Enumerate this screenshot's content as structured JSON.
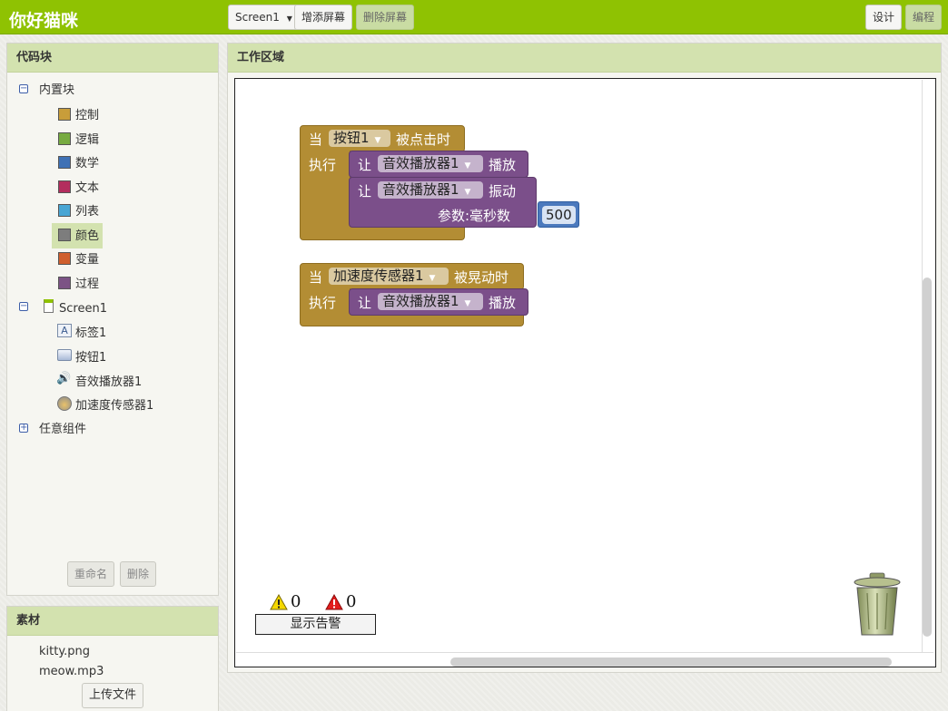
{
  "app": {
    "title": "你好猫咪"
  },
  "toolbar": {
    "screen_select": "Screen1",
    "add_screen": "增添屏幕",
    "remove_screen": "删除屏幕",
    "designer": "设计",
    "blocks": "编程"
  },
  "blocks_panel": {
    "title": "代码块",
    "builtin": {
      "label": "内置块",
      "items": [
        {
          "label": "控制",
          "color": "#c89d3a"
        },
        {
          "label": "逻辑",
          "color": "#77ab41"
        },
        {
          "label": "数学",
          "color": "#3f71b5"
        },
        {
          "label": "文本",
          "color": "#b32d5e"
        },
        {
          "label": "列表",
          "color": "#49a6d4"
        },
        {
          "label": "颜色",
          "color": "#7d7d7d"
        },
        {
          "label": "变量",
          "color": "#d05f2d"
        },
        {
          "label": "过程",
          "color": "#7c5385"
        }
      ]
    },
    "screen": {
      "label": "Screen1",
      "components": [
        {
          "label": "标签1",
          "icon": "label-icon"
        },
        {
          "label": "按钮1",
          "icon": "button-icon"
        },
        {
          "label": "音效播放器1",
          "icon": "speaker-icon"
        },
        {
          "label": "加速度传感器1",
          "icon": "accelerometer-icon"
        }
      ]
    },
    "any_component": "任意组件",
    "rename": "重命名",
    "delete": "删除"
  },
  "media_panel": {
    "title": "素材",
    "files": [
      "kitty.png",
      "meow.mp3"
    ],
    "upload": "上传文件"
  },
  "workspace": {
    "title": "工作区域",
    "block1": {
      "when": "当",
      "component": "按钮1",
      "event": "被点击时",
      "do": "执行",
      "stmt1": {
        "let": "让",
        "component": "音效播放器1",
        "method": "播放"
      },
      "stmt2": {
        "let": "让",
        "component": "音效播放器1",
        "method": "振动",
        "param": "参数:毫秒数",
        "value": "500"
      }
    },
    "block2": {
      "when": "当",
      "component": "加速度传感器1",
      "event": "被晃动时",
      "do": "执行",
      "stmt1": {
        "let": "让",
        "component": "音效播放器1",
        "method": "播放"
      }
    },
    "warnings": {
      "warning_count": "0",
      "error_count": "0",
      "toggle_label": "显示告警"
    }
  }
}
